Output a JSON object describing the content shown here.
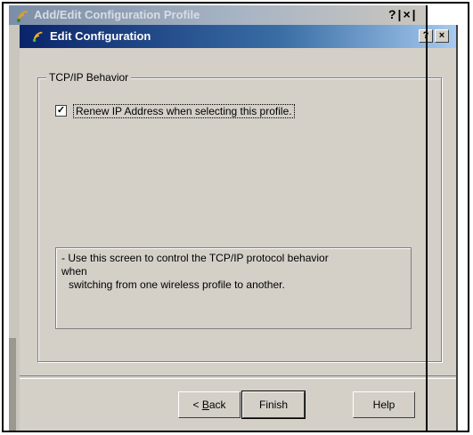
{
  "background_window": {
    "title": "Add/Edit Configuration Profile",
    "buttons": "?|×|",
    "icon": "wifi-signal-icon"
  },
  "dialog": {
    "title": "Edit Configuration",
    "icon": "wifi-signal-icon",
    "help_button": "?",
    "close_button": "×",
    "group_title": "TCP/IP Behavior",
    "checkbox": {
      "checked": true,
      "mark": "✓",
      "label": "Renew IP Address when selecting this profile."
    },
    "info": {
      "line1": "- Use this screen to control the TCP/IP protocol behavior",
      "line2": "when",
      "line3": "switching from one wireless profile to another."
    },
    "buttons": {
      "back_prefix": "< ",
      "back_accel": "B",
      "back_rest": "ack",
      "finish": "Finish",
      "help": "Help"
    }
  },
  "colors": {
    "title_active": "#0a246a",
    "dialog_face": "#d4d0c8"
  }
}
